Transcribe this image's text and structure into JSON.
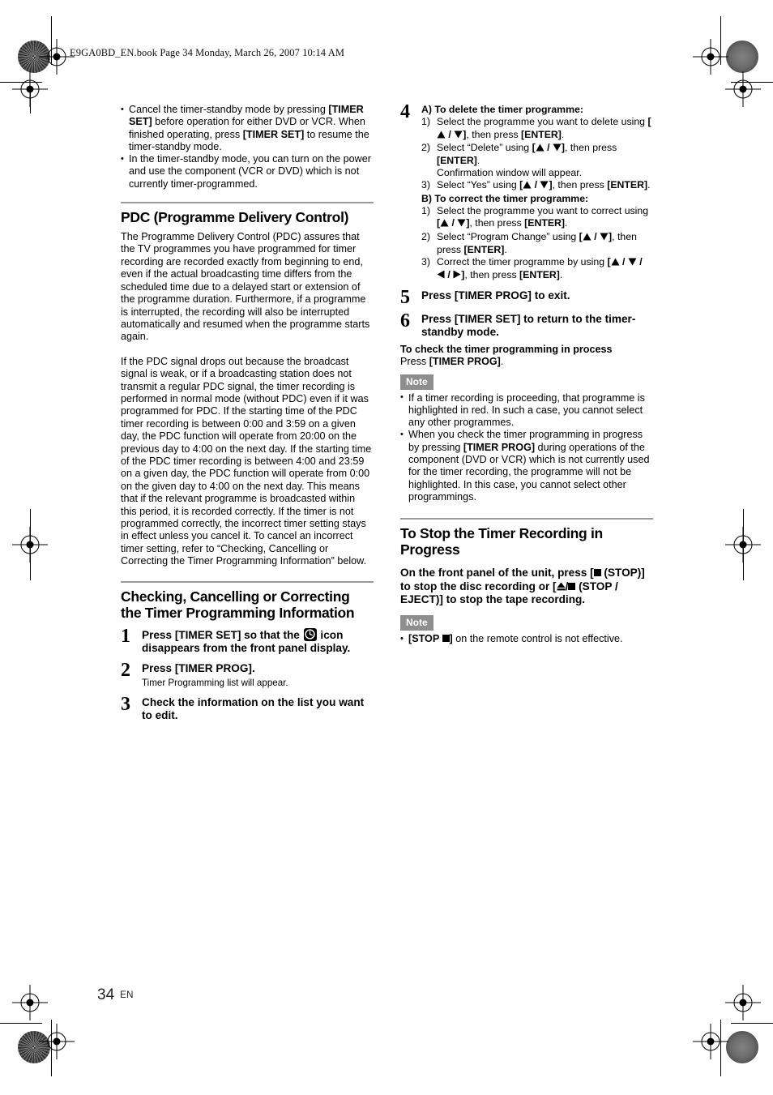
{
  "page": {
    "book_header": "E9GA0BD_EN.book  Page 34  Monday, March 26, 2007  10:14 AM",
    "page_number": "34",
    "language_code": "EN"
  },
  "left_column": {
    "intro_bullets": [
      {
        "parts": [
          {
            "t": "Cancel the timer-standby mode by pressing ",
            "b": false
          },
          {
            "t": "[TIMER SET]",
            "b": true
          },
          {
            "t": " before operation for either DVD or VCR. When finished operating, press ",
            "b": false
          },
          {
            "t": "[TIMER SET]",
            "b": true
          },
          {
            "t": " to resume the timer-standby mode.",
            "b": false
          }
        ]
      },
      {
        "parts": [
          {
            "t": "In the timer-standby mode, you can turn on the power and use the component (VCR or DVD) which is not currently timer-programmed.",
            "b": false
          }
        ]
      }
    ],
    "pdc": {
      "heading": "PDC (Programme Delivery Control)",
      "paragraph_1": "The Programme Delivery Control (PDC) assures that the TV programmes you have programmed for timer recording are recorded exactly from beginning to end, even if the actual broadcasting time differs from the scheduled time due to a delayed start or extension of the programme duration. Furthermore, if a programme is interrupted, the recording will also be interrupted automatically and resumed when the programme starts again.",
      "paragraph_2": "If the PDC signal drops out because the broadcast signal is weak, or if a broadcasting station does not transmit a regular PDC signal, the timer recording is performed in normal mode (without PDC) even if it was programmed for PDC. If the starting time of the PDC timer recording is between 0:00 and 3:59 on a given day, the PDC function will operate from 20:00 on the previous day to 4:00 on the next day. If the starting time of the PDC timer recording is between 4:00 and 23:59 on a given day, the PDC function will operate from 0:00 on the given day to 4:00 on the next day. This means that if the relevant programme is broadcasted within this period, it is recorded correctly. If the timer is not programmed correctly, the incorrect timer setting stays in effect unless you cancel it. To cancel an incorrect timer setting, refer to “Checking, Cancelling or Correcting the Timer Programming Information” below."
    },
    "checking": {
      "heading": "Checking, Cancelling or Correcting the Timer Programming Information",
      "steps": [
        {
          "num": "1",
          "head_before": "Press [TIMER SET] so that the ",
          "icon": "clock-icon",
          "head_after": " icon disappears from the front panel display.",
          "sub": ""
        },
        {
          "num": "2",
          "head_before": "Press [TIMER PROG].",
          "icon": "",
          "head_after": "",
          "sub": "Timer Programming list will appear."
        },
        {
          "num": "3",
          "head_before": "Check the information on the list you want to edit.",
          "icon": "",
          "head_after": "",
          "sub": ""
        }
      ]
    }
  },
  "right_column": {
    "step4": {
      "num": "4",
      "group_a_title": "A) To delete the timer programme:",
      "group_a_items": [
        {
          "marker": "1)",
          "parts": [
            {
              "t": "Select the programme you want to delete using ",
              "b": false
            },
            {
              "t": "[",
              "b": true
            },
            {
              "t": "ARROW_UP",
              "b": true
            },
            {
              "t": " / ",
              "b": true
            },
            {
              "t": "ARROW_DOWN",
              "b": true
            },
            {
              "t": "]",
              "b": true
            },
            {
              "t": ", then press ",
              "b": false
            },
            {
              "t": "[ENTER]",
              "b": true
            },
            {
              "t": ".",
              "b": false
            }
          ]
        },
        {
          "marker": "2)",
          "parts": [
            {
              "t": "Select “Delete” using ",
              "b": false
            },
            {
              "t": "[",
              "b": true
            },
            {
              "t": "ARROW_UP",
              "b": true
            },
            {
              "t": " / ",
              "b": true
            },
            {
              "t": "ARROW_DOWN",
              "b": true
            },
            {
              "t": "]",
              "b": true
            },
            {
              "t": ", then press ",
              "b": false
            },
            {
              "t": "[ENTER]",
              "b": true
            },
            {
              "t": ".",
              "b": false
            },
            {
              "t": "NEWLINE",
              "b": false
            },
            {
              "t": "Confirmation window will appear.",
              "b": false
            }
          ]
        },
        {
          "marker": "3)",
          "parts": [
            {
              "t": "Select “Yes” using ",
              "b": false
            },
            {
              "t": "[",
              "b": true
            },
            {
              "t": "ARROW_UP",
              "b": true
            },
            {
              "t": " / ",
              "b": true
            },
            {
              "t": "ARROW_DOWN",
              "b": true
            },
            {
              "t": "]",
              "b": true
            },
            {
              "t": ", then press ",
              "b": false
            },
            {
              "t": "[ENTER]",
              "b": true
            },
            {
              "t": ".",
              "b": false
            }
          ]
        }
      ],
      "group_b_title": "B) To correct the timer programme:",
      "group_b_items": [
        {
          "marker": "1)",
          "parts": [
            {
              "t": "Select the programme you want to correct using ",
              "b": false
            },
            {
              "t": "[",
              "b": true
            },
            {
              "t": "ARROW_UP",
              "b": true
            },
            {
              "t": " / ",
              "b": true
            },
            {
              "t": "ARROW_DOWN",
              "b": true
            },
            {
              "t": "]",
              "b": true
            },
            {
              "t": ", then press ",
              "b": false
            },
            {
              "t": "[ENTER]",
              "b": true
            },
            {
              "t": ".",
              "b": false
            }
          ]
        },
        {
          "marker": "2)",
          "parts": [
            {
              "t": "Select “Program Change” using ",
              "b": false
            },
            {
              "t": "[",
              "b": true
            },
            {
              "t": "ARROW_UP",
              "b": true
            },
            {
              "t": " / ",
              "b": true
            },
            {
              "t": "ARROW_DOWN",
              "b": true
            },
            {
              "t": "]",
              "b": true
            },
            {
              "t": ", then press ",
              "b": false
            },
            {
              "t": "[ENTER]",
              "b": true
            },
            {
              "t": ".",
              "b": false
            }
          ]
        },
        {
          "marker": "3)",
          "parts": [
            {
              "t": "Correct the timer programme by using ",
              "b": false
            },
            {
              "t": "[",
              "b": true
            },
            {
              "t": "ARROW_UP",
              "b": true
            },
            {
              "t": " / ",
              "b": true
            },
            {
              "t": "ARROW_DOWN",
              "b": true
            },
            {
              "t": " / ",
              "b": true
            },
            {
              "t": "ARROW_LEFT",
              "b": true
            },
            {
              "t": " / ",
              "b": true
            },
            {
              "t": "ARROW_RIGHT",
              "b": true
            },
            {
              "t": "]",
              "b": true
            },
            {
              "t": ", then press ",
              "b": false
            },
            {
              "t": "[ENTER]",
              "b": true
            },
            {
              "t": ".",
              "b": false
            }
          ]
        }
      ]
    },
    "step5": {
      "num": "5",
      "text": "Press [TIMER PROG] to exit."
    },
    "step6": {
      "num": "6",
      "text": "Press [TIMER SET] to return to the timer-standby mode."
    },
    "check_process": {
      "title": "To check the timer programming in process",
      "line_normal": "Press ",
      "line_bold": "[TIMER PROG]",
      "line_end": "."
    },
    "note_1": {
      "label": "Note",
      "bullets": [
        {
          "parts": [
            {
              "t": "If a timer recording is proceeding, that programme is highlighted in red. In such a case, you cannot select any other programmes.",
              "b": false
            }
          ]
        },
        {
          "parts": [
            {
              "t": "When you check the timer programming in progress by pressing ",
              "b": false
            },
            {
              "t": "[TIMER PROG]",
              "b": true
            },
            {
              "t": " during operations of the component (DVD or VCR) which is not currently used for the timer recording, the programme will not be highlighted. In this case, you cannot select other programmings.",
              "b": false
            }
          ]
        }
      ]
    },
    "stop_section": {
      "heading": "To Stop the Timer Recording in Progress",
      "body_parts": [
        {
          "t": "On the front panel of the unit, press [",
          "b": true
        },
        {
          "t": "SQUARE",
          "b": true
        },
        {
          "t": "  (STOP)] to stop the disc recording or [",
          "b": true
        },
        {
          "t": "EJECT",
          "b": true
        },
        {
          "t": "/",
          "b": true
        },
        {
          "t": "SQUARE",
          "b": true
        },
        {
          "t": "  (STOP / EJECT)] to stop the tape recording.",
          "b": true
        }
      ],
      "note": {
        "label": "Note",
        "bullets": [
          {
            "parts": [
              {
                "t": "[STOP ",
                "b": true
              },
              {
                "t": "SQUARE",
                "b": true
              },
              {
                "t": "]",
                "b": true
              },
              {
                "t": " on the remote control is not effective.",
                "b": false
              }
            ]
          }
        ]
      }
    }
  },
  "colors": {
    "rule": "#9a9a9a",
    "note_badge_bg": "#8e8e8e",
    "note_badge_text": "#ffffff",
    "text": "#000000"
  }
}
